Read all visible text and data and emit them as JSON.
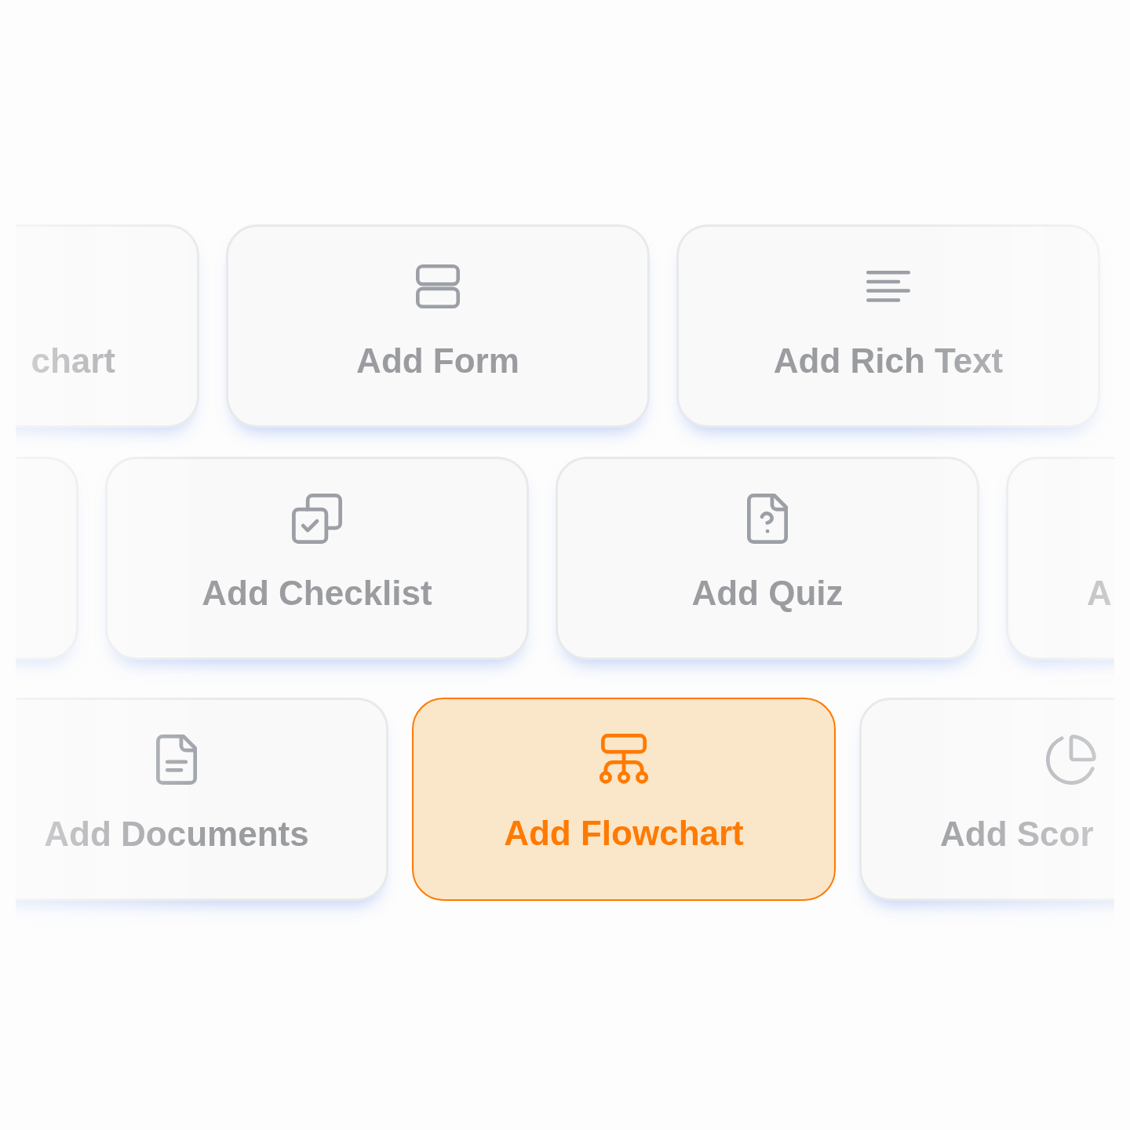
{
  "rows": [
    {
      "cards": [
        {
          "label": "chart",
          "kind": "partial_left",
          "selected": false
        },
        {
          "label": "Add Form",
          "kind": "form",
          "selected": false
        },
        {
          "label": "Add Rich Text",
          "kind": "rich_text",
          "selected": false
        }
      ]
    },
    {
      "cards": [
        {
          "kind": "partial_left",
          "selected": false
        },
        {
          "label": "Add Checklist",
          "kind": "checklist",
          "selected": false
        },
        {
          "label": "Add Quiz",
          "kind": "quiz",
          "selected": false
        },
        {
          "label": "A",
          "kind": "partial_right",
          "selected": false
        }
      ]
    },
    {
      "cards": [
        {
          "label": "Add Documents",
          "kind": "documents",
          "selected": false
        },
        {
          "label": "Add Flowchart",
          "kind": "flowchart",
          "selected": true
        },
        {
          "label": "Add Scor",
          "kind": "score",
          "selected": false
        }
      ]
    }
  ]
}
